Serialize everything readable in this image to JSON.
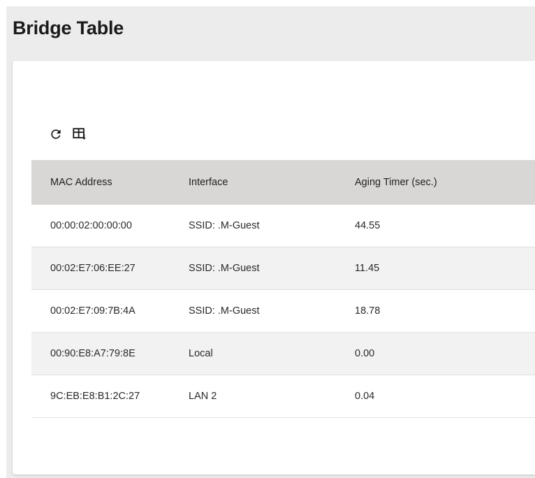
{
  "page": {
    "title": "Bridge Table"
  },
  "toolbar": {
    "refresh_icon": "refresh-icon",
    "export_icon": "table-export-icon"
  },
  "table": {
    "columns": [
      "MAC Address",
      "Interface",
      "Aging Timer (sec.)"
    ],
    "rows": [
      [
        "00:00:02:00:00:00",
        "SSID: .M-Guest",
        "44.55"
      ],
      [
        "00:02:E7:06:EE:27",
        "SSID: .M-Guest",
        "11.45"
      ],
      [
        "00:02:E7:09:7B:4A",
        "SSID: .M-Guest",
        "18.78"
      ],
      [
        "00:90:E8:A7:79:8E",
        "Local",
        "0.00"
      ],
      [
        "9C:EB:E8:B1:2C:27",
        "LAN 2",
        "0.04"
      ]
    ]
  },
  "colors": {
    "header_bg": "#d9d7d5",
    "alt_row_bg": "#f2f2f2",
    "page_bg": "#ececec"
  }
}
